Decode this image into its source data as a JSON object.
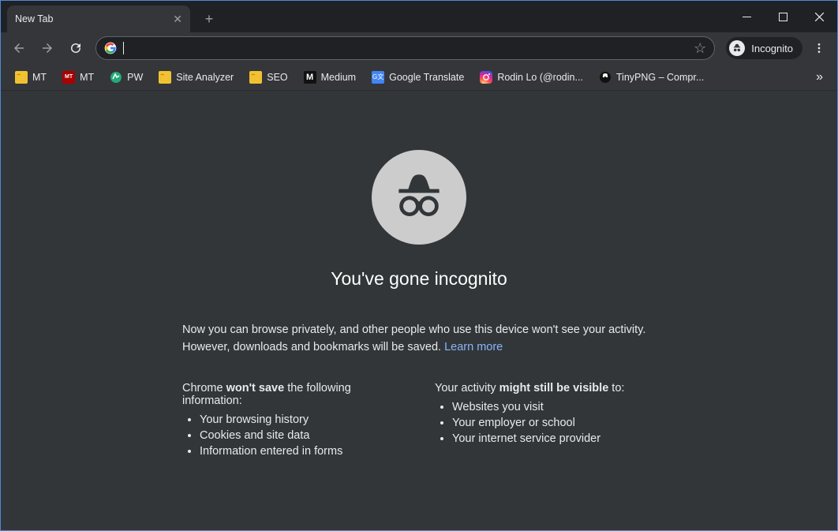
{
  "tab": {
    "title": "New Tab"
  },
  "toolbar": {
    "incognito_label": "Incognito"
  },
  "omnibox": {
    "placeholder": ""
  },
  "bookmarks": [
    {
      "icon": "folder",
      "label": "MT"
    },
    {
      "icon": "mt",
      "label": "MT"
    },
    {
      "icon": "pw",
      "label": "PW"
    },
    {
      "icon": "folder",
      "label": "Site Analyzer"
    },
    {
      "icon": "folder",
      "label": "SEO"
    },
    {
      "icon": "medium",
      "label": "Medium"
    },
    {
      "icon": "gt",
      "label": "Google Translate"
    },
    {
      "icon": "ig",
      "label": "Rodin Lo (@rodin..."
    },
    {
      "icon": "tp",
      "label": "TinyPNG – Compr..."
    }
  ],
  "page": {
    "heading": "You've gone incognito",
    "intro1": "Now you can browse privately, and other people who use this device won't see your activity.",
    "intro2": "However, downloads and bookmarks will be saved. ",
    "learn_more": "Learn more",
    "col1_lead1": "Chrome ",
    "col1_lead_bold": "won't save",
    "col1_lead2": " the following information:",
    "col1_items": [
      "Your browsing history",
      "Cookies and site data",
      "Information entered in forms"
    ],
    "col2_lead1": "Your activity ",
    "col2_lead_bold": "might still be visible",
    "col2_lead2": " to:",
    "col2_items": [
      "Websites you visit",
      "Your employer or school",
      "Your internet service provider"
    ]
  }
}
